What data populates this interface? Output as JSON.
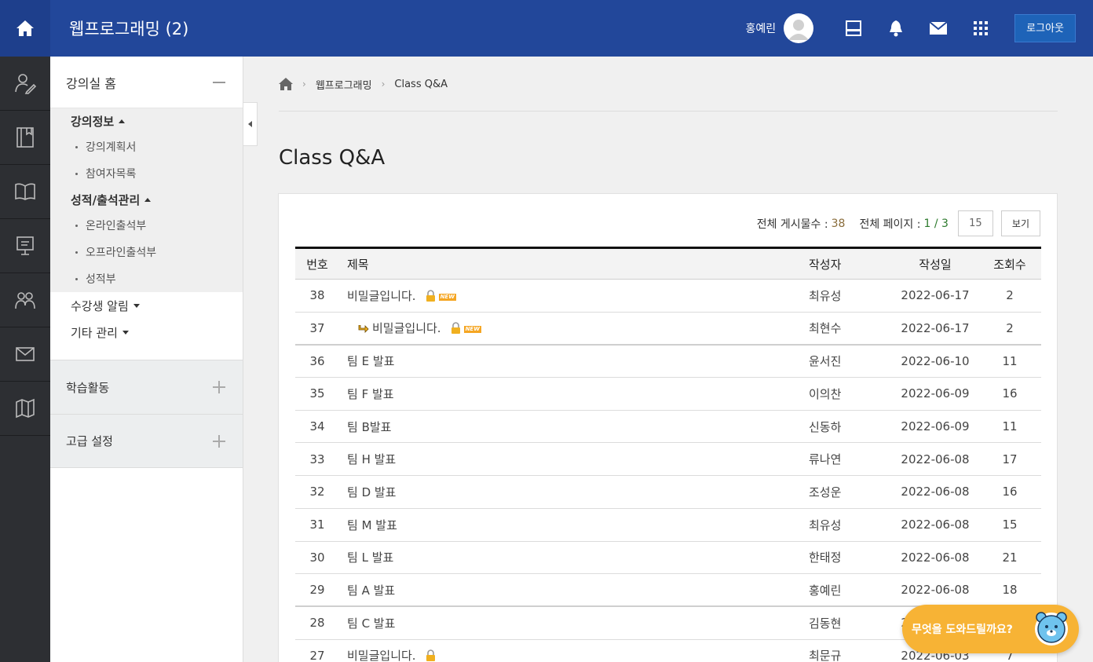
{
  "header": {
    "course_title": "웹프로그래밍 (2)",
    "user_name": "홍예린",
    "logout_label": "로그아웃",
    "bg_color": "#22479a"
  },
  "sidebar": {
    "home_label": "강의실 홈",
    "groups": [
      {
        "title": "강의정보",
        "items": [
          "강의계획서",
          "참여자목록"
        ]
      },
      {
        "title": "성적/출석관리",
        "items": [
          "온라인출석부",
          "오프라인출석부",
          "성적부"
        ]
      }
    ],
    "plain_items": [
      "수강생 알림",
      "기타 관리"
    ],
    "sections": [
      "학습활동",
      "고급 설정"
    ]
  },
  "breadcrumb": [
    "웹프로그래밍",
    "Class Q&A"
  ],
  "page_title": "Class Q&A",
  "board": {
    "total_label": "전체 게시물수 :",
    "total_count": "38",
    "pages_label": "전체 페이지 :",
    "pages_value": "1 / 3",
    "per_page": "15",
    "view_button": "보기",
    "columns": [
      "번호",
      "제목",
      "작성자",
      "작성일",
      "조회수"
    ],
    "rows": [
      {
        "num": "38",
        "title": "비밀글입니다.",
        "author": "최유성",
        "date": "2022-06-17",
        "views": "2"
      },
      {
        "num": "37",
        "title": "비밀글입니다.",
        "author": "최현수",
        "date": "2022-06-17",
        "views": "2"
      },
      {
        "num": "36",
        "title": "팀 E 발표",
        "author": "윤서진",
        "date": "2022-06-10",
        "views": "11"
      },
      {
        "num": "35",
        "title": "팀 F 발표",
        "author": "이의찬",
        "date": "2022-06-09",
        "views": "16"
      },
      {
        "num": "34",
        "title": "팀 B발표",
        "author": "신동하",
        "date": "2022-06-09",
        "views": "11"
      },
      {
        "num": "33",
        "title": "팀 H 발표",
        "author": "류나연",
        "date": "2022-06-08",
        "views": "17"
      },
      {
        "num": "32",
        "title": "팀 D 발표",
        "author": "조성운",
        "date": "2022-06-08",
        "views": "16"
      },
      {
        "num": "31",
        "title": "팀 M 발표",
        "author": "최유성",
        "date": "2022-06-08",
        "views": "15"
      },
      {
        "num": "30",
        "title": "팀 L 발표",
        "author": "한태정",
        "date": "2022-06-08",
        "views": "21"
      },
      {
        "num": "29",
        "title": "팀 A 발표",
        "author": "홍예린",
        "date": "2022-06-08",
        "views": "18"
      },
      {
        "num": "28",
        "title": "팀 C 발표",
        "author": "김동현",
        "date": "2022-06-08",
        "views": ""
      },
      {
        "num": "27",
        "title": "비밀글입니다.",
        "author": "최문규",
        "date": "2022-06-03",
        "views": "7"
      }
    ]
  },
  "chat": {
    "label": "무엇을 도와드릴까요?"
  }
}
